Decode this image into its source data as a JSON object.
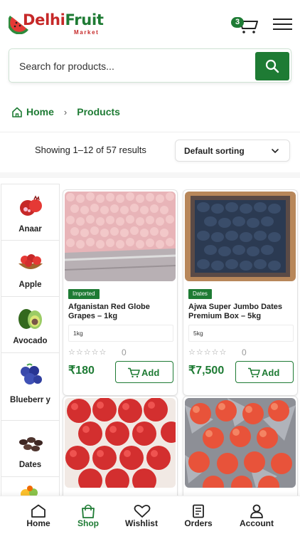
{
  "brand": {
    "logo_first": "D",
    "logo_rest": "elhi",
    "logo_accent": "Fruit",
    "logo_sub": "Market",
    "green": "#1e7b34",
    "red": "#c62828"
  },
  "header": {
    "cart_count": "3",
    "cart_icon": "cart-icon",
    "menu_icon": "hamburger-menu-icon"
  },
  "search": {
    "placeholder": "Search for products...",
    "button_icon": "search-icon"
  },
  "breadcrumb": {
    "home": "Home",
    "separator": "›",
    "current": "Products"
  },
  "results": {
    "text": "Showing 1–12 of 57 results",
    "sort_selected": "Default sorting"
  },
  "categories": [
    {
      "name": "Anaar"
    },
    {
      "name": "Apple"
    },
    {
      "name": "Avocado"
    },
    {
      "name": "Blueberr y"
    },
    {
      "name": "Dates"
    },
    {
      "name": ""
    }
  ],
  "products": [
    {
      "tag": "Imported",
      "name": "Afganistan Red Globe Grapes – 1kg",
      "variant": "1kg",
      "stars": "☆☆☆☆☆",
      "rating_count": "0",
      "price": "₹180",
      "add_label": "Add"
    },
    {
      "tag": "Dates",
      "name": "Ajwa Super Jumbo Dates Premium Box – 5kg",
      "variant": "5kg",
      "stars": "☆☆☆☆☆",
      "rating_count": "0",
      "price": "₹7,500",
      "add_label": "Add"
    }
  ],
  "nav": {
    "home": "Home",
    "shop": "Shop",
    "wishlist": "Wishlist",
    "orders": "Orders",
    "account": "Account"
  }
}
